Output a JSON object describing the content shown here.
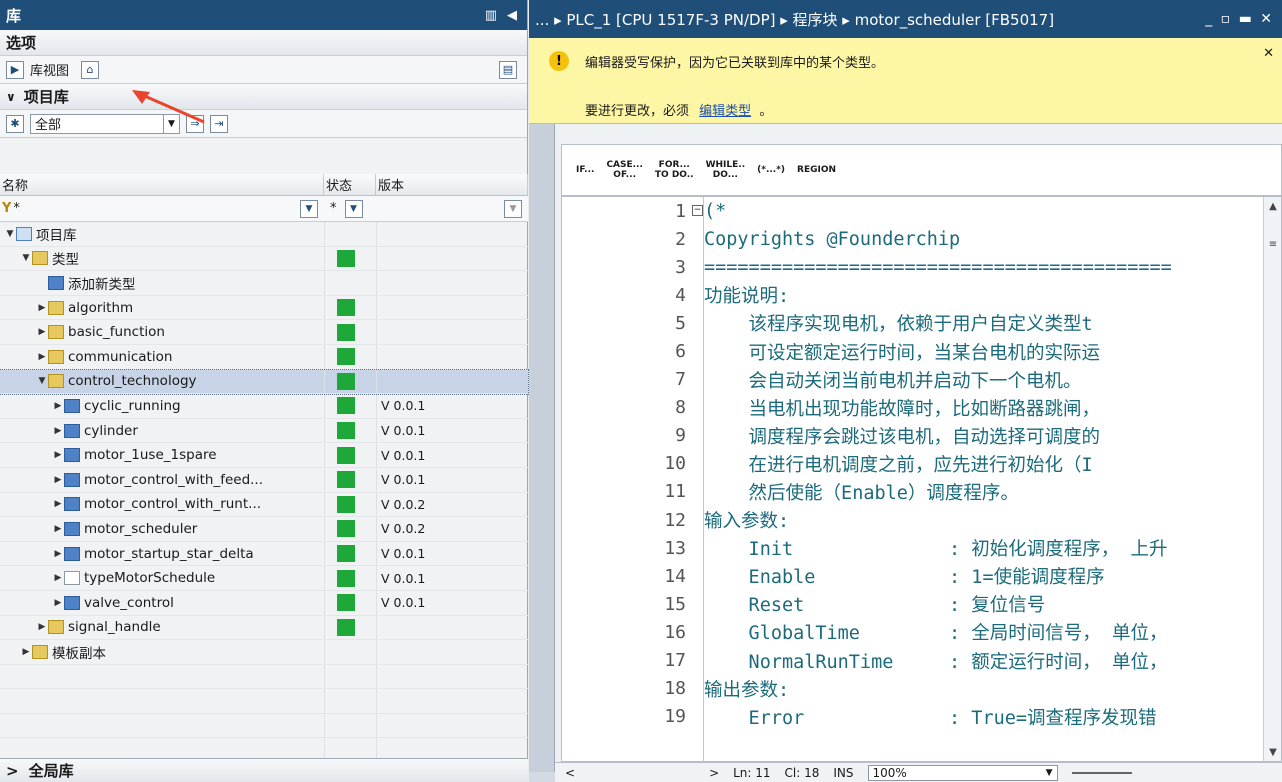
{
  "left_title": "库",
  "options_header": "选项",
  "library_view_label": "库视图",
  "project_lib_header": "项目库",
  "filter_value": "全部",
  "columns": {
    "name": "名称",
    "status": "状态",
    "version": "版本"
  },
  "filter_row": {
    "name_filter": "*",
    "status_filter": "*"
  },
  "tree": [
    {
      "label": "项目库",
      "level": 0,
      "expand": "▼",
      "icon": "lib",
      "status": false,
      "version": ""
    },
    {
      "label": "类型",
      "level": 1,
      "expand": "▼",
      "icon": "folder",
      "status": true,
      "version": ""
    },
    {
      "label": "添加新类型",
      "level": 2,
      "expand": "",
      "icon": "add",
      "status": false,
      "version": ""
    },
    {
      "label": "algorithm",
      "level": 2,
      "expand": "▶",
      "icon": "folder",
      "status": true,
      "version": ""
    },
    {
      "label": "basic_function",
      "level": 2,
      "expand": "▶",
      "icon": "folder",
      "status": true,
      "version": ""
    },
    {
      "label": "communication",
      "level": 2,
      "expand": "▶",
      "icon": "folder",
      "status": true,
      "version": ""
    },
    {
      "label": "control_technology",
      "level": 2,
      "expand": "▼",
      "icon": "folder",
      "status": true,
      "version": "",
      "selected": true
    },
    {
      "label": "cyclic_running",
      "level": 3,
      "expand": "▶",
      "icon": "blue",
      "status": true,
      "version": "V 0.0.1"
    },
    {
      "label": "cylinder",
      "level": 3,
      "expand": "▶",
      "icon": "blue",
      "status": true,
      "version": "V 0.0.1"
    },
    {
      "label": "motor_1use_1spare",
      "level": 3,
      "expand": "▶",
      "icon": "blue",
      "status": true,
      "version": "V 0.0.1"
    },
    {
      "label": "motor_control_with_feed...",
      "level": 3,
      "expand": "▶",
      "icon": "blue",
      "status": true,
      "version": "V 0.0.1"
    },
    {
      "label": "motor_control_with_runt...",
      "level": 3,
      "expand": "▶",
      "icon": "blue",
      "status": true,
      "version": "V 0.0.2"
    },
    {
      "label": "motor_scheduler",
      "level": 3,
      "expand": "▶",
      "icon": "blue",
      "status": true,
      "version": "V 0.0.2"
    },
    {
      "label": "motor_startup_star_delta",
      "level": 3,
      "expand": "▶",
      "icon": "blue",
      "status": true,
      "version": "V 0.0.1"
    },
    {
      "label": "typeMotorSchedule",
      "level": 3,
      "expand": "▶",
      "icon": "file",
      "status": true,
      "version": "V 0.0.1"
    },
    {
      "label": "valve_control",
      "level": 3,
      "expand": "▶",
      "icon": "blue",
      "status": true,
      "version": "V 0.0.1"
    },
    {
      "label": "signal_handle",
      "level": 2,
      "expand": "▶",
      "icon": "folder",
      "status": true,
      "version": ""
    },
    {
      "label": "模板副本",
      "level": 1,
      "expand": "▶",
      "icon": "folder",
      "status": false,
      "version": ""
    }
  ],
  "global_lib_header": "全局库",
  "breadcrumb": "... ▸ PLC_1 [CPU 1517F-3 PN/DP] ▸ 程序块 ▸ motor_scheduler [FB5017]",
  "warning": {
    "line1": "编辑器受写保护，因为它已关联到库中的某个类型。",
    "line2_prefix": "要进行更改，必须",
    "link": "编辑类型",
    "line2_suffix": "。"
  },
  "code_toolbar": [
    {
      "l1": "IF...",
      "l2": ""
    },
    {
      "l1": "CASE...",
      "l2": "OF..."
    },
    {
      "l1": "FOR...",
      "l2": "TO DO.."
    },
    {
      "l1": "WHILE..",
      "l2": "DO..."
    },
    {
      "l1": "(*...*)",
      "l2": ""
    },
    {
      "l1": "REGION",
      "l2": ""
    }
  ],
  "code_lines": [
    "(*",
    "Copyrights @Founderchip",
    "==========================================",
    "功能说明:",
    "    该程序实现电机，依赖于用户自定义类型t",
    "    可设定额定运行时间，当某台电机的实际运",
    "    会自动关闭当前电机并启动下一个电机。",
    "    当电机出现功能故障时，比如断路器跳闸，",
    "    调度程序会跳过该电机，自动选择可调度的",
    "    在进行电机调度之前，应先进行初始化（I",
    "    然后使能（Enable）调度程序。",
    "输入参数:",
    "    Init              : 初始化调度程序， 上升",
    "    Enable            : 1=使能调度程序",
    "    Reset             : 复位信号",
    "    GlobalTime        : 全局时间信号， 单位，",
    "    NormalRunTime     : 额定运行时间， 单位，",
    "输出参数:",
    "    Error             : True=调查程序发现错"
  ],
  "status_bar": {
    "ln": "Ln: 11",
    "cl": "Cl: 18",
    "mode": "INS",
    "zoom": "100%"
  }
}
